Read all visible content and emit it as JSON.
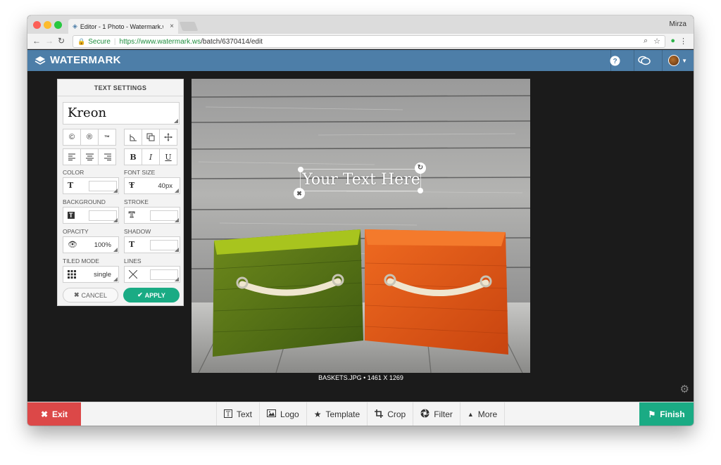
{
  "browser": {
    "tab_title": "Editor - 1 Photo - Watermark.ws",
    "tab_close": "×",
    "user_name": "Mirza",
    "secure_label": "Secure",
    "url_host": "https://www.watermark.ws",
    "url_path": "/batch/6370414/edit"
  },
  "app": {
    "logo_text": "WATERMARK",
    "header_bg": "#4d7ea8"
  },
  "text_settings": {
    "title": "TEXT SETTINGS",
    "font_name": "Kreon",
    "symbols": [
      "©",
      "®",
      "™"
    ],
    "transform_icons": [
      "angle-icon",
      "duplicate-icon",
      "move-icon"
    ],
    "align_icons": [
      "align-left-icon",
      "align-center-icon",
      "align-right-icon"
    ],
    "style_buttons": [
      "B",
      "I",
      "U"
    ],
    "color_label": "COLOR",
    "font_size_label": "FONT SIZE",
    "font_size_value": "40px",
    "background_label": "BACKGROUND",
    "stroke_label": "STROKE",
    "opacity_label": "OPACITY",
    "opacity_value": "100%",
    "shadow_label": "SHADOW",
    "tiled_mode_label": "TILED MODE",
    "tiled_mode_value": "single",
    "lines_label": "LINES",
    "cancel_label": "CANCEL",
    "apply_label": "APPLY",
    "apply_color": "#1aab84"
  },
  "canvas": {
    "watermark_text": "Your Text Here",
    "caption": "BASKETS.JPG • 1461 X 1269"
  },
  "toolbar": {
    "exit_label": "Exit",
    "finish_label": "Finish",
    "tools": [
      "Text",
      "Logo",
      "Template",
      "Crop",
      "Filter",
      "More"
    ],
    "exit_color": "#dc4848",
    "finish_color": "#1aab84"
  }
}
